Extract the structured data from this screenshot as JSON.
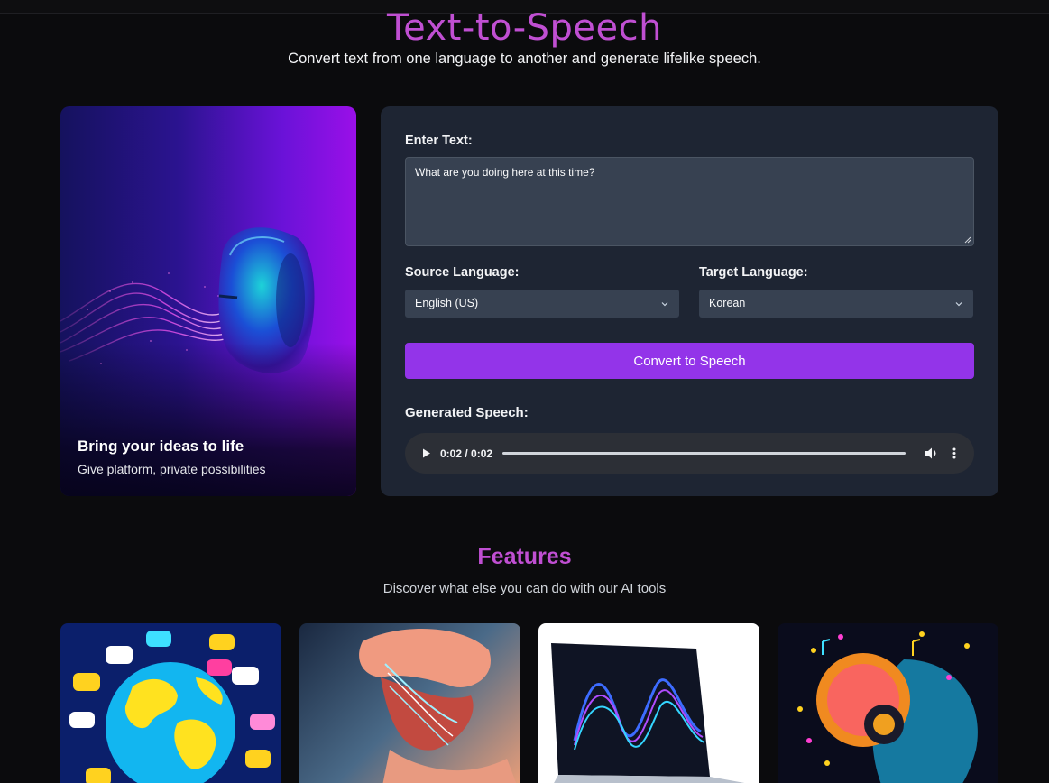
{
  "hero": {
    "title": "Text-to-Speech",
    "subtitle": "Convert text from one language to another and generate lifelike speech."
  },
  "image_card": {
    "title": "Bring your ideas to life",
    "subtitle": "Give platform, private possibilities"
  },
  "form": {
    "enter_text_label": "Enter Text:",
    "text_value": "What are you doing here at this time?",
    "source_label": "Source Language:",
    "source_value": "English (US)",
    "target_label": "Target Language:",
    "target_value": "Korean",
    "convert_label": "Convert to Speech",
    "generated_label": "Generated Speech:",
    "audio_time": "0:02 / 0:02"
  },
  "features": {
    "title": "Features",
    "subtitle": "Discover what else you can do with our AI tools",
    "cards": [
      {
        "icon": "globe-chat-icon"
      },
      {
        "icon": "lips-voice-icon"
      },
      {
        "icon": "laptop-waveform-icon"
      },
      {
        "icon": "brain-music-icon"
      }
    ]
  },
  "colors": {
    "accent_title": "#c04fd2",
    "button": "#9334e9",
    "panel": "#1e2533",
    "background": "#0b0b0d"
  }
}
